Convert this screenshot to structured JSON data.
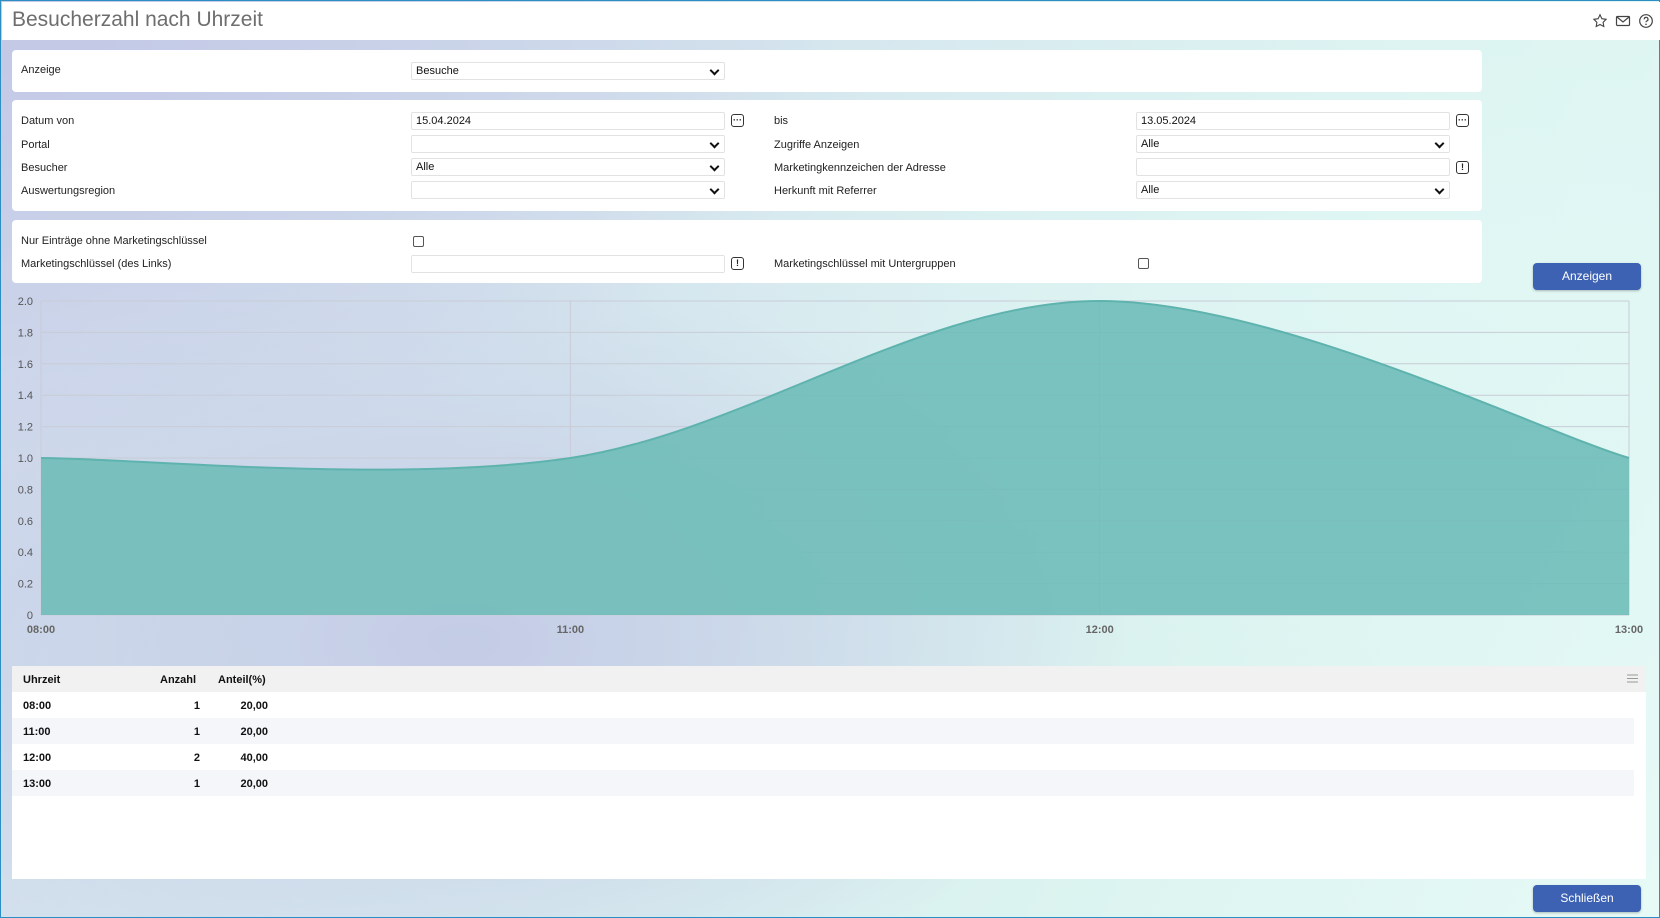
{
  "header": {
    "title": "Besucherzahl nach Uhrzeit",
    "icons": [
      "star-icon",
      "mail-icon",
      "help-icon"
    ]
  },
  "display_panel": {
    "anzeige_label": "Anzeige",
    "anzeige_value": "Besuche"
  },
  "filter_panel": {
    "datum_von_label": "Datum von",
    "datum_von_value": "15.04.2024",
    "bis_label": "bis",
    "bis_value": "13.05.2024",
    "portal_label": "Portal",
    "portal_value": "",
    "zugriffe_label": "Zugriffe Anzeigen",
    "zugriffe_value": "Alle",
    "besucher_label": "Besucher",
    "besucher_value": "Alle",
    "marketingkennzeichen_label": "Marketingkennzeichen der Adresse",
    "marketingkennzeichen_value": "",
    "auswertungsregion_label": "Auswertungsregion",
    "auswertungsregion_value": "",
    "herkunft_label": "Herkunft mit Referrer",
    "herkunft_value": "Alle"
  },
  "marketing_panel": {
    "nur_eintraege_label": "Nur Einträge ohne Marketingschlüssel",
    "nur_eintraege_checked": false,
    "schluessel_label": "Marketingschlüssel (des Links)",
    "schluessel_value": "",
    "untergruppen_label": "Marketingschlüssel mit Untergruppen",
    "untergruppen_checked": false
  },
  "buttons": {
    "anzeigen": "Anzeigen",
    "schliessen": "Schließen"
  },
  "chart_data": {
    "type": "area",
    "x": [
      "08:00",
      "11:00",
      "12:00",
      "13:00"
    ],
    "series": [
      {
        "values": [
          1,
          1,
          2,
          1
        ]
      }
    ],
    "ylim": [
      0,
      2.0
    ],
    "yticks": [
      "0",
      "0.2",
      "0.4",
      "0.6",
      "0.8",
      "1.0",
      "1.2",
      "1.4",
      "1.6",
      "1.8",
      "2.0"
    ],
    "grid": true,
    "fill_color": "#6fbcb9",
    "line_color": "#5fb3ae"
  },
  "table": {
    "columns": [
      "Uhrzeit",
      "Anzahl",
      "Anteil(%)"
    ],
    "rows": [
      [
        "08:00",
        "1",
        "20,00"
      ],
      [
        "11:00",
        "1",
        "20,00"
      ],
      [
        "12:00",
        "2",
        "40,00"
      ],
      [
        "13:00",
        "1",
        "20,00"
      ]
    ]
  }
}
